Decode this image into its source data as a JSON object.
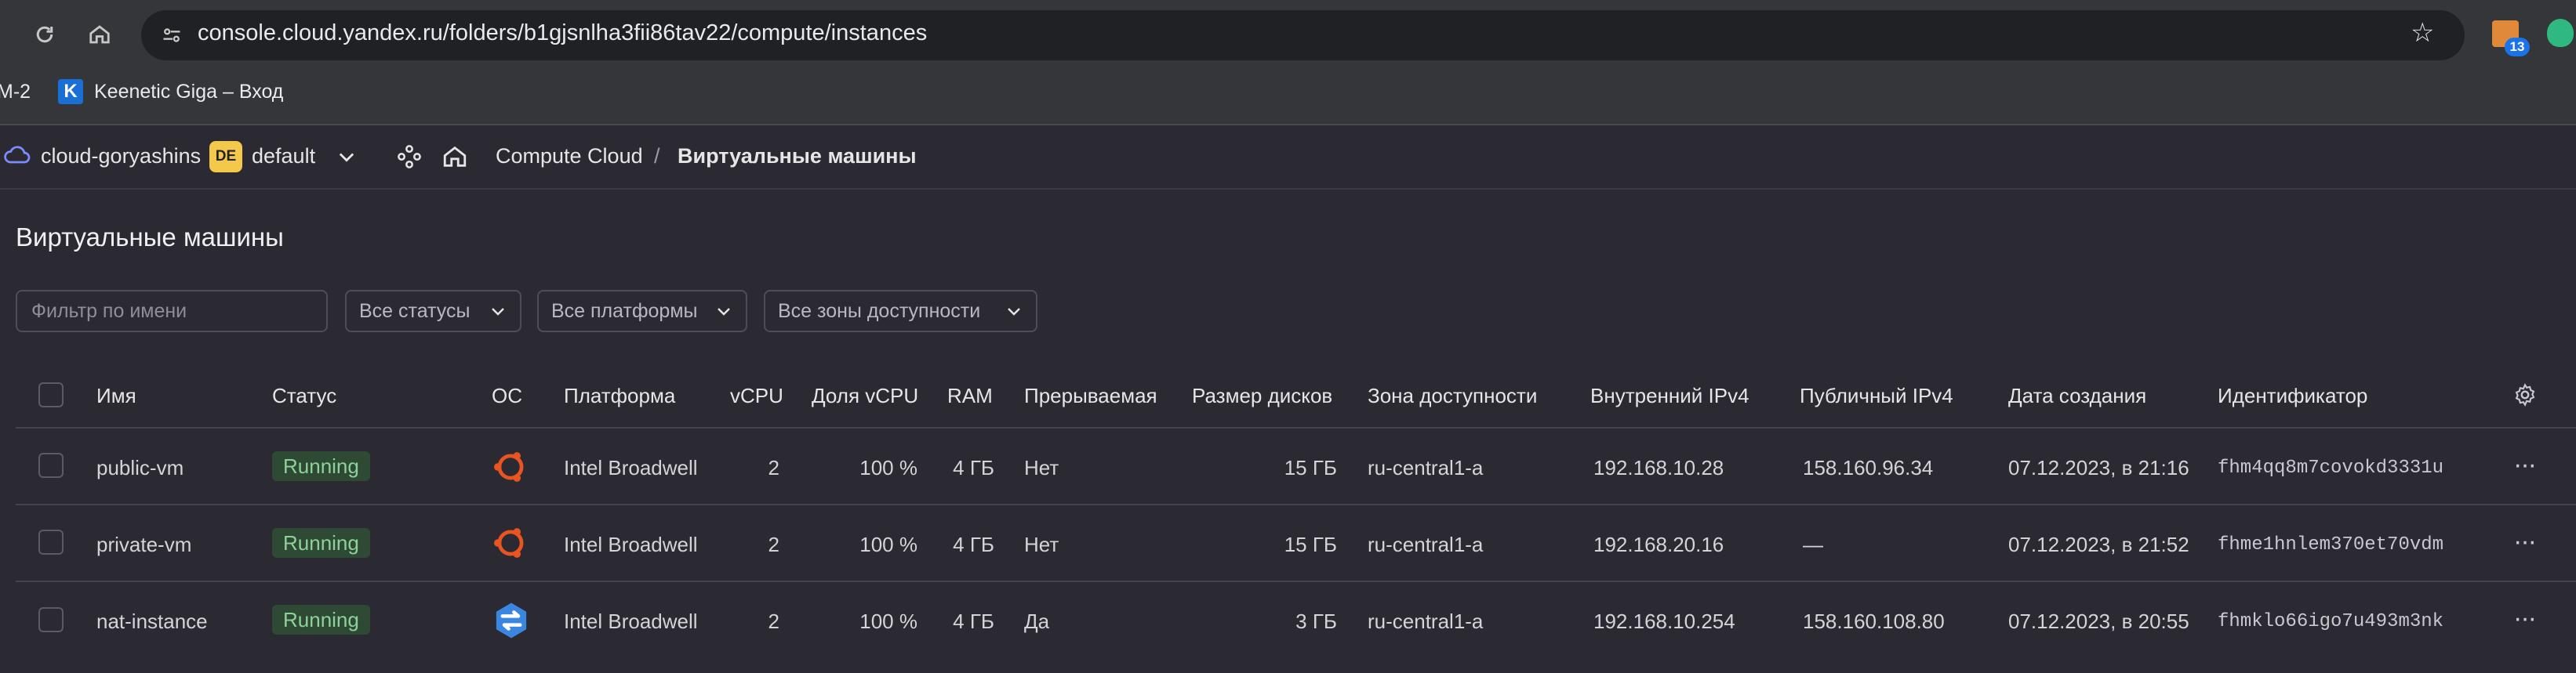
{
  "browser": {
    "url": "console.cloud.yandex.ru/folders/b1gjsnlha3fii86tav22/compute/instances",
    "extension_badge": "13",
    "bookmarks": [
      {
        "label": "M-2"
      },
      {
        "label": "Keenetic Giga – Вход",
        "icon_letter": "K"
      }
    ]
  },
  "console": {
    "cloud_name": "cloud-goryashins",
    "folder_badge": "DE",
    "folder_name": "default",
    "breadcrumb_service": "Compute Cloud",
    "breadcrumb_separator": "/",
    "breadcrumb_current": "Виртуальные машины"
  },
  "page": {
    "title": "Виртуальные машины",
    "filter_placeholder": "Фильтр по имени",
    "status_select": "Все статусы",
    "platform_select": "Все платформы",
    "zone_select": "Все зоны доступности"
  },
  "table": {
    "headers": {
      "name": "Имя",
      "status": "Статус",
      "os": "ОС",
      "platform": "Платформа",
      "vcpu": "vCPU",
      "vcpu_share": "Доля vCPU",
      "ram": "RAM",
      "preemptible": "Прерываемая",
      "disk_size": "Размер дисков",
      "zone": "Зона доступности",
      "internal_ip": "Внутренний IPv4",
      "public_ip": "Публичный IPv4",
      "created": "Дата создания",
      "id": "Идентификатор"
    },
    "rows": [
      {
        "name": "public-vm",
        "status": "Running",
        "os_icon": "ubuntu-icon",
        "platform": "Intel Broadwell",
        "vcpu": "2",
        "vcpu_share": "100 %",
        "ram": "4 ГБ",
        "preemptible": "Нет",
        "disk_size": "15 ГБ",
        "zone": "ru-central1-a",
        "internal_ip": "192.168.10.28",
        "public_ip": "158.160.96.34",
        "created": "07.12.2023, в 21:16",
        "id": "fhm4qq8m7covokd3331u"
      },
      {
        "name": "private-vm",
        "status": "Running",
        "os_icon": "ubuntu-icon",
        "platform": "Intel Broadwell",
        "vcpu": "2",
        "vcpu_share": "100 %",
        "ram": "4 ГБ",
        "preemptible": "Нет",
        "disk_size": "15 ГБ",
        "zone": "ru-central1-a",
        "internal_ip": "192.168.20.16",
        "public_ip": "—",
        "created": "07.12.2023, в 21:52",
        "id": "fhme1hnlem370et70vdm"
      },
      {
        "name": "nat-instance",
        "status": "Running",
        "os_icon": "nat-instance-icon",
        "platform": "Intel Broadwell",
        "vcpu": "2",
        "vcpu_share": "100 %",
        "ram": "4 ГБ",
        "preemptible": "Да",
        "disk_size": "3 ГБ",
        "zone": "ru-central1-a",
        "internal_ip": "192.168.10.254",
        "public_ip": "158.160.108.80",
        "created": "07.12.2023, в 20:55",
        "id": "fhmklo66igo7u493m3nk"
      }
    ]
  },
  "colors": {
    "background": "#2b2a33",
    "status_running_bg": "#2f4a34",
    "status_running_text": "#8fd19a",
    "ubuntu_orange": "#e95420",
    "nat_blue": "#3a86e0",
    "folder_badge": "#f4c84a"
  }
}
